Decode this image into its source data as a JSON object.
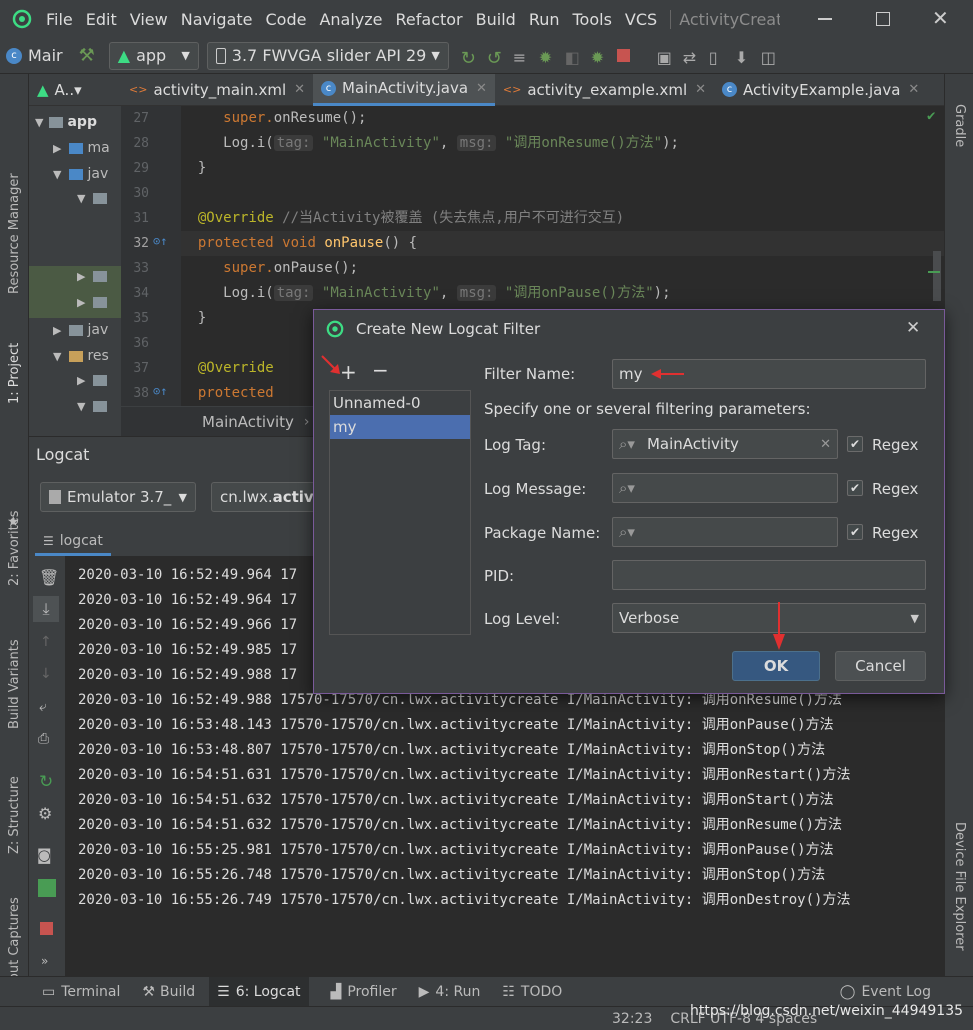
{
  "menu": {
    "items": [
      "File",
      "Edit",
      "View",
      "Navigate",
      "Code",
      "Analyze",
      "Refactor",
      "Build",
      "Run",
      "Tools",
      "VCS"
    ],
    "window_title": "ActivityCreat"
  },
  "toolbar": {
    "project": "Mair",
    "module": "app",
    "device": "3.7  FWVGA slider API 29"
  },
  "editor_tabs": [
    {
      "label": "activity_main.xml",
      "active": false
    },
    {
      "label": "MainActivity.java",
      "active": true
    },
    {
      "label": "activity_example.xml",
      "active": false
    },
    {
      "label": "ActivityExample.java",
      "active": false
    }
  ],
  "project_panel": {
    "tab_label": "A..▾",
    "items": [
      "app",
      "ma",
      "jav",
      "",
      "",
      "",
      "jav",
      "res",
      "",
      ""
    ]
  },
  "left_strip": {
    "resource_manager": "Resource Manager",
    "project": "1: Project",
    "favorites": "2: Favorites",
    "build_variants": "Build Variants",
    "structure": "Z: Structure",
    "layout_captures": "Layout Captures"
  },
  "right_strip": {
    "gradle": "Gradle",
    "device_file_explorer": "Device File Explorer"
  },
  "code": {
    "line_numbers": [
      "27",
      "28",
      "29",
      "30",
      "31",
      "32",
      "33",
      "34",
      "35",
      "36",
      "37",
      "38"
    ],
    "l27_a": "super.",
    "l27_b": "onResume();",
    "l28_a": "Log.i(",
    "l28_tag": "tag:",
    "l28_str1": "\"MainActivity\"",
    "l28_msg": "msg:",
    "l28_str2": "\"调用onResume()方法\"",
    "l28_end": ");",
    "l29": "}",
    "l31_an": "@Override",
    "l31_cm": "//当Activity被覆盖 (失去焦点,用户不可进行交互)",
    "l32_kw1": "protected",
    "l32_kw2": "void",
    "l32_fn": "onPause",
    "l32_end": "() {",
    "l33_a": "super.",
    "l33_b": "onPause",
    "l33_c": "();",
    "l34_a": "Log.i(",
    "l34_tag": "tag:",
    "l34_str1": "\"MainActivity\"",
    "l34_msg": "msg:",
    "l34_str2": "\"调用onPause()方法\"",
    "l34_end": ");",
    "l35": "}",
    "l37_an": "@Override",
    "l38_kw": "protected"
  },
  "breadcrumb": "MainActivity",
  "logcat": {
    "title": "Logcat",
    "device": "Emulator 3.7_",
    "process_prefix": "cn.lwx.",
    "process_bold": "activit",
    "subtab": "logcat",
    "lines_partial": [
      "2020-03-10 16:52:49.964 17",
      "2020-03-10 16:52:49.964 17",
      "2020-03-10 16:52:49.966 17",
      "2020-03-10 16:52:49.985 17",
      "2020-03-10 16:52:49.988 17"
    ],
    "lines": [
      "2020-03-10 16:52:49.988 17570-17570/cn.lwx.activitycreate I/MainActivity: 调用onResume()方法",
      "2020-03-10 16:53:48.143 17570-17570/cn.lwx.activitycreate I/MainActivity: 调用onPause()方法",
      "2020-03-10 16:53:48.807 17570-17570/cn.lwx.activitycreate I/MainActivity: 调用onStop()方法",
      "2020-03-10 16:54:51.631 17570-17570/cn.lwx.activitycreate I/MainActivity: 调用onRestart()方法",
      "2020-03-10 16:54:51.632 17570-17570/cn.lwx.activitycreate I/MainActivity: 调用onStart()方法",
      "2020-03-10 16:54:51.632 17570-17570/cn.lwx.activitycreate I/MainActivity: 调用onResume()方法",
      "2020-03-10 16:55:25.981 17570-17570/cn.lwx.activitycreate I/MainActivity: 调用onPause()方法",
      "2020-03-10 16:55:26.748 17570-17570/cn.lwx.activitycreate I/MainActivity: 调用onStop()方法",
      "2020-03-10 16:55:26.749 17570-17570/cn.lwx.activitycreate I/MainActivity: 调用onDestroy()方法"
    ]
  },
  "bottom_tabs": {
    "terminal": "Terminal",
    "build": "Build",
    "logcat": "6: Logcat",
    "profiler": "Profiler",
    "run": "4: Run",
    "todo": "TODO",
    "event_log": "Event Log"
  },
  "status": {
    "position": "32:23",
    "rest": "CRLF  UTF-8  4 spaces",
    "watermark": "https://blog.csdn.net/weixin_44949135"
  },
  "dialog": {
    "title": "Create New Logcat Filter",
    "filters": [
      "Unnamed-0",
      "my"
    ],
    "selected_filter": "my",
    "filter_name_label": "Filter Name:",
    "filter_name_value": "my",
    "params_hint": "Specify one or several filtering parameters:",
    "log_tag_label": "Log Tag:",
    "log_tag_value": "MainActivity",
    "log_message_label": "Log Message:",
    "package_name_label": "Package Name:",
    "pid_label": "PID:",
    "log_level_label": "Log Level:",
    "log_level_value": "Verbose",
    "regex_label": "Regex",
    "ok_label": "OK",
    "cancel_label": "Cancel",
    "accent": "#365880",
    "annotation_color": "#e03030"
  }
}
